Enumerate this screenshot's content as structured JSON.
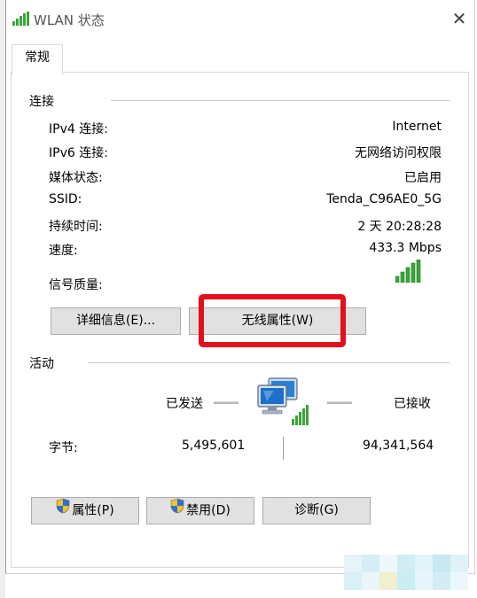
{
  "window": {
    "title": "WLAN 状态",
    "close_glyph": "✕"
  },
  "tabs": [
    {
      "label": "常规"
    }
  ],
  "connection": {
    "title": "连接",
    "rows": [
      {
        "label": "IPv4 连接:",
        "value": "Internet"
      },
      {
        "label": "IPv6 连接:",
        "value": "无网络访问权限"
      },
      {
        "label": "媒体状态:",
        "value": "已启用"
      },
      {
        "label": "SSID:",
        "value": "Tenda_C96AE0_5G"
      },
      {
        "label": "持续时间:",
        "value": "2 天 20:28:28"
      },
      {
        "label": "速度:",
        "value": "433.3 Mbps"
      }
    ],
    "signal_label": "信号质量:",
    "signal_icon": "signal-bars-icon",
    "details_button": "详细信息(E)...",
    "wireless_button": "无线属性(W)",
    "highlight_color": "#e3101c"
  },
  "activity": {
    "title": "活动",
    "sent_label": "已发送",
    "received_label": "已接收",
    "bytes_label": "字节:",
    "bytes_sent": "5,495,601",
    "bytes_received": "94,341,564",
    "network_icon": "network-computers-icon"
  },
  "buttons": {
    "properties": "属性(P)",
    "disable": "禁用(D)",
    "diagnose": "诊断(G)",
    "shield_icon": "uac-shield-icon"
  },
  "colors": {
    "signal_green": "#3aa63a",
    "accent": "#0078d7"
  }
}
